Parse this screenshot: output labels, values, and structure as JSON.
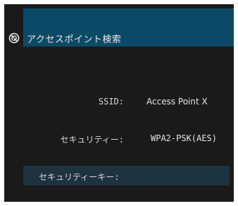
{
  "header": {
    "icon": "globe-icon",
    "title": "アクセスポイント検索"
  },
  "fields": {
    "ssid_label": "SSID:",
    "ssid_value": "Access Point X",
    "security_label": "セキュリティー:",
    "security_value": "WPA2-PSK(AES)",
    "security_key_label": "セキュリティーキー:"
  },
  "colors": {
    "background": "#1a1a1a",
    "header": "#0b4a66",
    "key_row": "#1e3340",
    "text": "#e6e6e6"
  }
}
